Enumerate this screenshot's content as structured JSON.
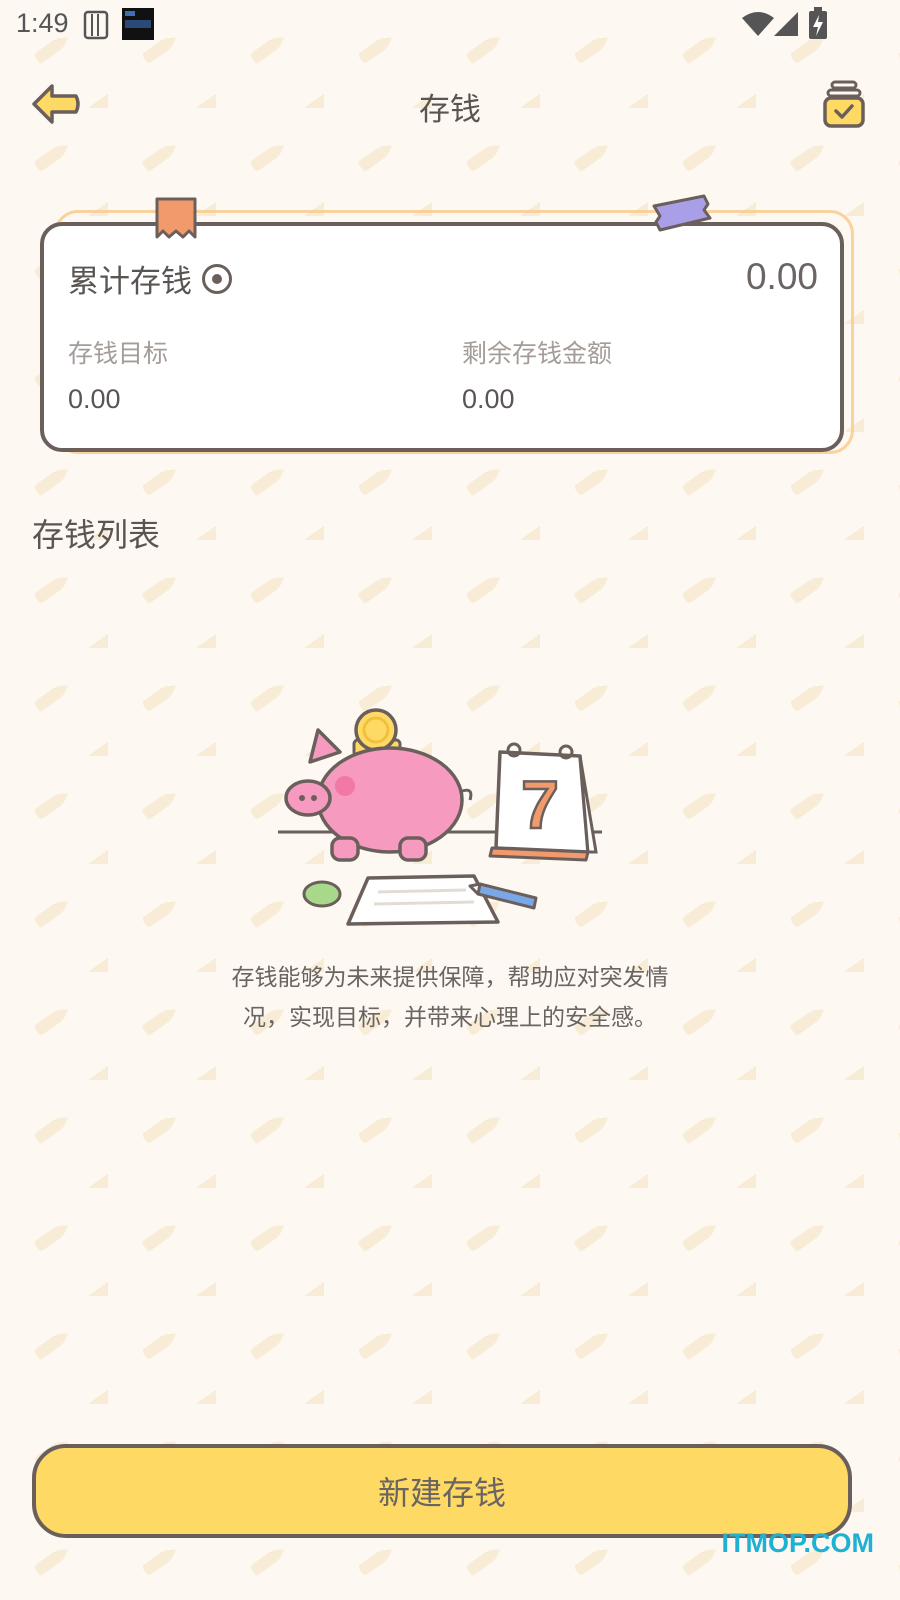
{
  "status_bar": {
    "time": "1:49"
  },
  "header": {
    "title": "存钱",
    "back_icon": "arrow-left-icon",
    "jar_icon": "jar-check-icon"
  },
  "summary_card": {
    "title": "累计存钱",
    "total_value": "0.00",
    "goal_label": "存钱目标",
    "goal_value": "0.00",
    "remaining_label": "剩余存钱金额",
    "remaining_value": "0.00"
  },
  "list_section": {
    "title": "存钱列表",
    "calendar_day": "7",
    "empty_text_line1": "存钱能够为未来提供保障，帮助应对突发情",
    "empty_text_line2": "况，实现目标，并带来心理上的安全感。"
  },
  "actions": {
    "new_button_label": "新建存钱"
  },
  "watermark": "ITMOP.COM",
  "colors": {
    "background": "#fdf8f1",
    "accent_yellow": "#fed963",
    "outline": "#6b5f5c",
    "piggy_pink": "#f79ac0",
    "tape_orange": "#f39a6c",
    "tape_purple": "#a99ee8",
    "watermark": "#1eb1d4"
  }
}
